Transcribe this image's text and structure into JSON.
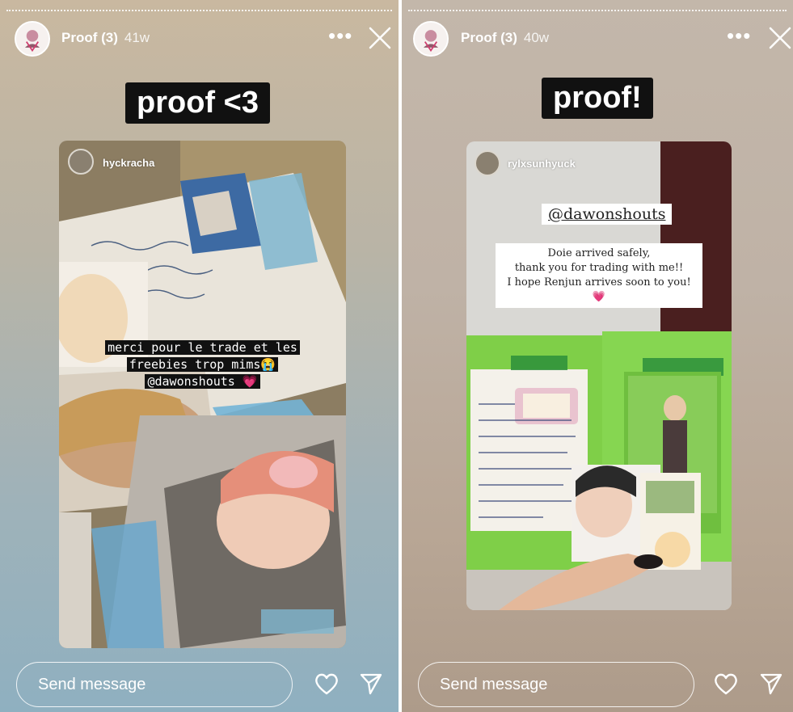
{
  "stories": [
    {
      "username": "Proof (3)",
      "age": "41w",
      "more_icon": "more-icon",
      "close_icon": "close-icon",
      "caption": "proof <3",
      "photo_user": "hyckracha",
      "overlay_lines": [
        "merci pour le trade et les",
        "freebies trop mims😭",
        "@dawonshouts 💗"
      ],
      "message_placeholder": "Send message"
    },
    {
      "username": "Proof (3)",
      "age": "40w",
      "more_icon": "more-icon",
      "close_icon": "close-icon",
      "caption": "proof!",
      "photo_user": "rylxsunhyuck",
      "mention": "@dawonshouts",
      "note_lines": [
        "Doie arrived safely,",
        "thank you for trading with me!!",
        "I hope Renjun arrives soon to you! 💗"
      ],
      "message_placeholder": "Send message"
    }
  ]
}
